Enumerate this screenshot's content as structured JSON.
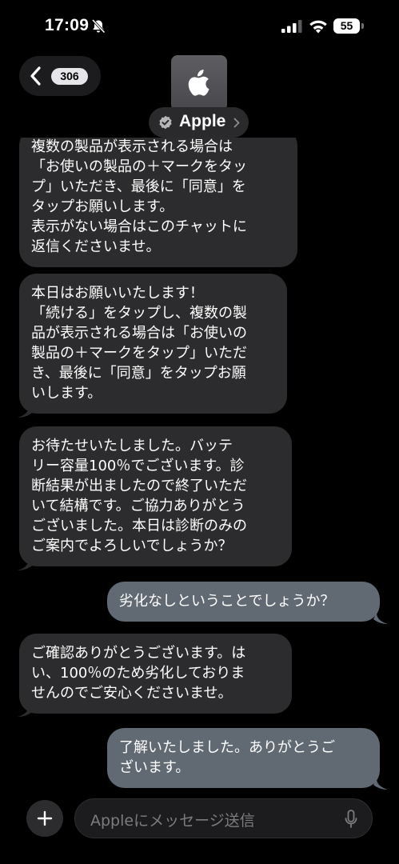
{
  "status_bar": {
    "time": "17:09",
    "battery_level": "55",
    "icons": [
      "bell-slash-icon",
      "cellular-signal-icon",
      "wifi-icon",
      "battery-icon"
    ]
  },
  "header": {
    "unread_count": "306",
    "contact_name": "Apple",
    "icons": [
      "chevron-left-icon",
      "apple-logo-icon",
      "verified-badge-icon",
      "chevron-right-icon"
    ]
  },
  "messages": [
    {
      "direction": "incoming",
      "text": "複数の製品が表示される場合は\n「お使いの製品の＋マークをタッ\nプ」いただき、最後に「同意」を\nタップお願いします。\n表示がない場合はこのチャットに\n返信くださいませ。"
    },
    {
      "direction": "incoming",
      "text": "本日はお願いいたします！\n「続ける」をタップし、複数の製\n品が表示される場合は「お使いの\n製品の＋マークをタップ」いただ\nき、最後に「同意」をタップお願\nいします。"
    },
    {
      "direction": "incoming",
      "text": "お待たせいたしました。バッテ\nリー容量100％でございます。診\n断結果が出ましたので終了いただ\nいて結構です。ご協力ありがとう\nございました。本日は診断のみの\nご案内でよろしいでしょうか？"
    },
    {
      "direction": "outgoing",
      "text": "劣化なしということでしょうか？"
    },
    {
      "direction": "incoming",
      "text": "ご確認ありがとうございます。は\nい、100％のため劣化しておりま\nせんのでご安心くださいませ。"
    },
    {
      "direction": "outgoing",
      "text": "了解いたしました。ありがとうご\nざいます。"
    }
  ],
  "composer": {
    "placeholder": "Appleにメッセージ送信",
    "icons": [
      "plus-icon",
      "microphone-icon"
    ]
  },
  "colors": {
    "background": "#000000",
    "incoming_bubble": "#2c2c2e",
    "outgoing_bubble": "#616a72"
  }
}
